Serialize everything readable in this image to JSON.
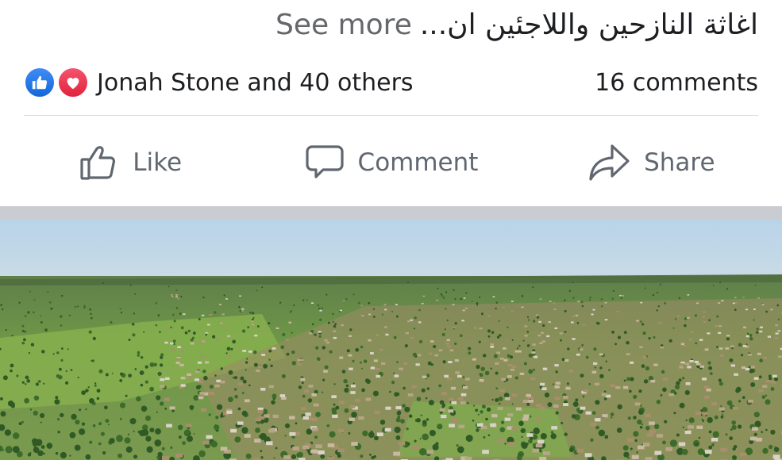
{
  "post": {
    "caption_text": "اغاثة النازحين واللاجئين ان...",
    "see_more_label": "See more"
  },
  "reactions": {
    "summary": "Jonah Stone and 40 others",
    "types": [
      "like-icon",
      "love-icon"
    ],
    "comments_count": "16 comments"
  },
  "actions": {
    "like_label": "Like",
    "comment_label": "Comment",
    "share_label": "Share"
  },
  "colors": {
    "like_blue": "#1877f2",
    "love_red": "#f0284a",
    "muted_text": "#65676b",
    "divider": "#dadde1"
  }
}
